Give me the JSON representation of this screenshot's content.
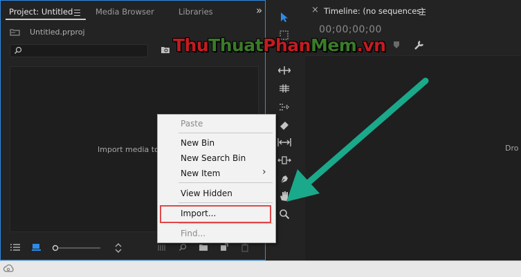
{
  "project_panel": {
    "tabs": [
      {
        "label": "Project: Untitled"
      },
      {
        "label": "Media Browser"
      },
      {
        "label": "Libraries"
      }
    ],
    "overflow_glyph": "»",
    "project_file": "Untitled.prproj",
    "search_placeholder": "",
    "empty_hint": "Import media to s"
  },
  "timeline_panel": {
    "title": "Timeline: (no sequences)",
    "close_glyph": "×",
    "timecode": "00;00;00;00",
    "drop_hint": "Dro"
  },
  "context_menu": {
    "items": [
      {
        "label": "Paste",
        "enabled": false
      },
      {
        "label": "New Bin",
        "enabled": true
      },
      {
        "label": "New Search Bin",
        "enabled": true
      },
      {
        "label": "New Item",
        "enabled": true,
        "submenu": "›"
      },
      {
        "label": "View Hidden",
        "enabled": true
      },
      {
        "label": "Import...",
        "enabled": true,
        "highlighted": true
      },
      {
        "label": "Find...",
        "enabled": false
      }
    ]
  },
  "watermark": {
    "parts": [
      "Thu",
      "Thuat",
      "Phan",
      "Mem",
      ".vn"
    ]
  },
  "colors": {
    "accent_blue": "#2d8ceb",
    "arrow_teal": "#1aa98a",
    "highlight_red": "#e0474a",
    "watermark_red": "#c41b22",
    "watermark_green": "#3b7a2a"
  }
}
